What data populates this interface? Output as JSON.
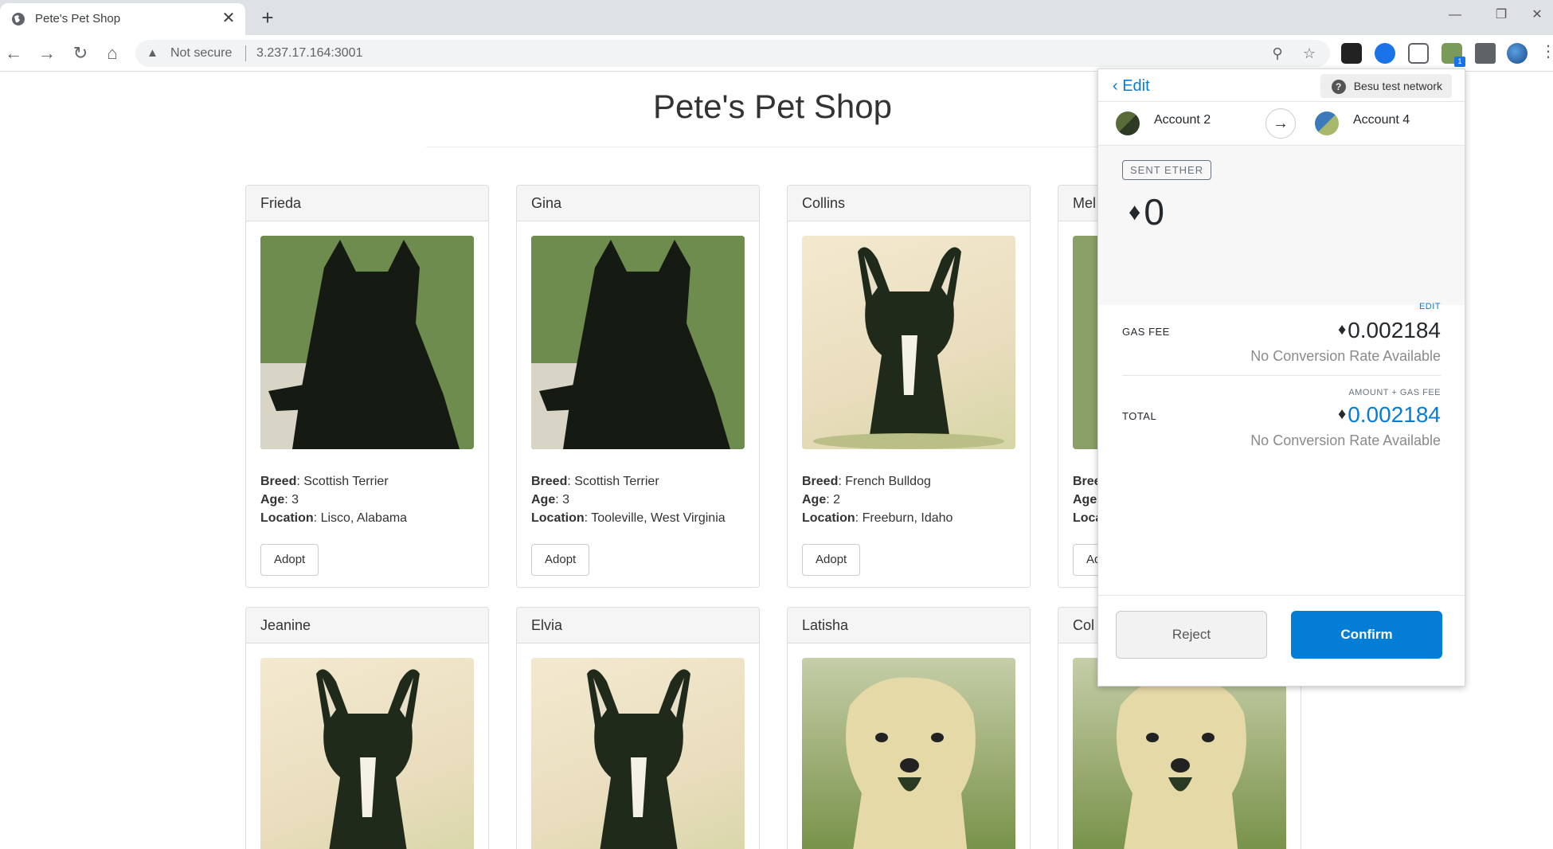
{
  "browser": {
    "tab_title": "Pete's Pet Shop",
    "tab_close": "✕",
    "new_tab": "+",
    "not_secure": "Not secure",
    "url": "3.237.17.164:3001",
    "ext_badge": "1",
    "nav": {
      "back": "←",
      "forward": "→",
      "reload": "↻",
      "home": "⌂"
    },
    "window": {
      "minimize": "—",
      "restore": "❐",
      "close": "✕"
    }
  },
  "page": {
    "title": "Pete's Pet Shop",
    "adopt_label": "Adopt",
    "labels": {
      "breed": "Breed",
      "age": "Age",
      "location": "Location"
    },
    "pets": [
      {
        "name": "Frieda",
        "breed": "Scottish Terrier",
        "age": "3",
        "location": "Lisco, Alabama"
      },
      {
        "name": "Gina",
        "breed": "Scottish Terrier",
        "age": "3",
        "location": "Tooleville, West Virginia"
      },
      {
        "name": "Collins",
        "breed": "French Bulldog",
        "age": "2",
        "location": "Freeburn, Idaho"
      },
      {
        "name": "Mel",
        "breed": "Bree",
        "age": "Age",
        "location": "Loca",
        "adopt": "Ad"
      },
      {
        "name": "Jeanine"
      },
      {
        "name": "Elvia"
      },
      {
        "name": "Latisha"
      },
      {
        "name": "Col"
      }
    ]
  },
  "metamask": {
    "back_label": "Edit",
    "network": "Besu test network",
    "network_icon": "?",
    "from_account": "Account 2",
    "to_account": "Account 4",
    "sent_label": "SENT ETHER",
    "sent_amount": "0",
    "edit_label": "EDIT",
    "gas_fee_label": "GAS FEE",
    "gas_fee_value": "0.002184",
    "conversion_text": "No Conversion Rate Available",
    "amount_gas_label": "AMOUNT + GAS FEE",
    "total_label": "TOTAL",
    "total_value": "0.002184",
    "reject_label": "Reject",
    "confirm_label": "Confirm",
    "eth_symbol": "♦",
    "colors": {
      "accent": "#037dd6",
      "reject_bg": "#f2f2f2"
    }
  }
}
